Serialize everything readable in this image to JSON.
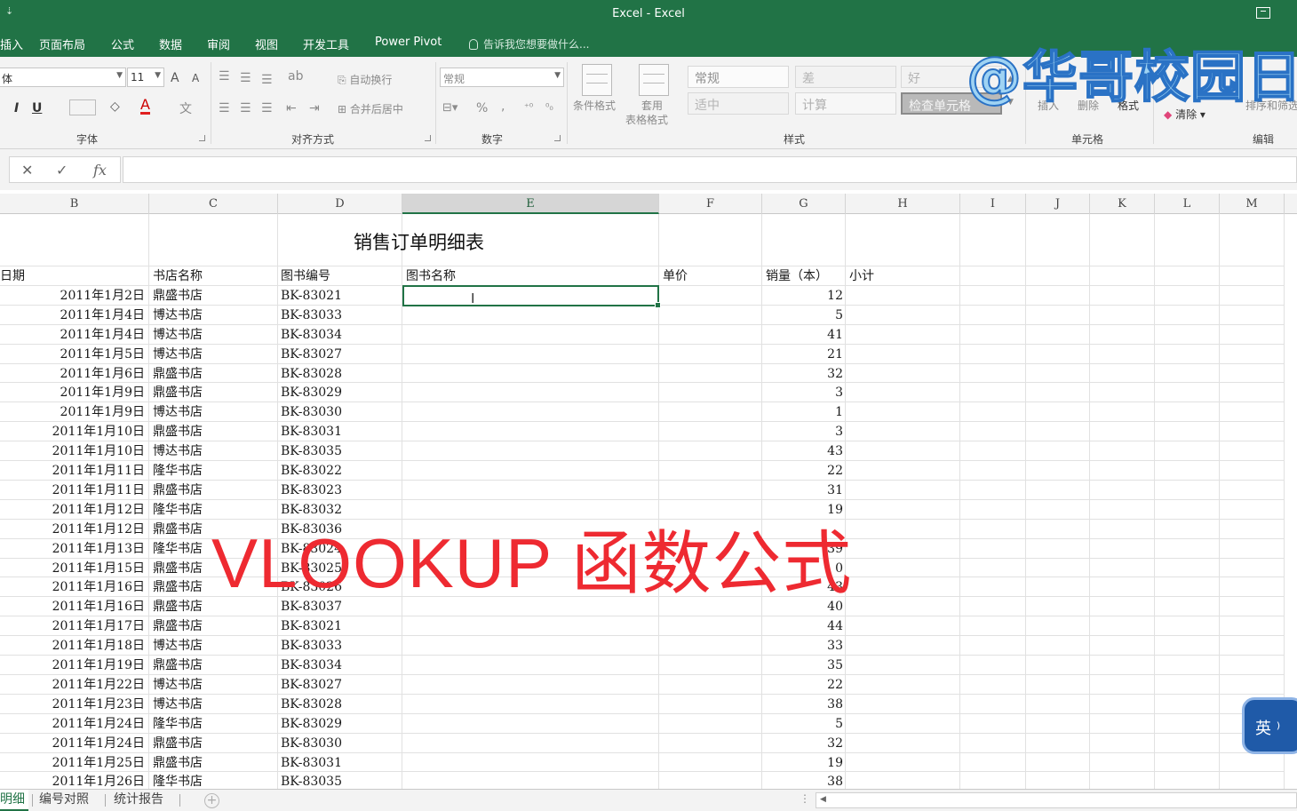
{
  "window": {
    "title": "Excel - Excel",
    "quick_access": "⇣"
  },
  "tabs": [
    "插入",
    "页面布局",
    "公式",
    "数据",
    "审阅",
    "视图",
    "开发工具",
    "Power Pivot"
  ],
  "tell_me": "告诉我您想要做什么...",
  "ribbon": {
    "font_name": "体",
    "font_size": "11",
    "grow_font": "A",
    "shrink_font": "A",
    "italic": "I",
    "underline": "U",
    "font_color": "A",
    "group_font": "字体",
    "wrap_text": "自动换行",
    "merge_center": "合并后居中",
    "group_alignment": "对齐方式",
    "number_format": "常规",
    "percent": "%",
    "comma": ",",
    "group_number": "数字",
    "conditional_format": "条件格式",
    "format_table_1": "套用",
    "format_table_2": "表格格式",
    "styles": [
      "常规",
      "差",
      "好",
      "适中",
      "计算",
      "检查单元格"
    ],
    "group_styles": "样式",
    "insert": "插入",
    "delete": "删除",
    "format": "格式",
    "group_cells": "单元格",
    "clear": "清除",
    "sort_filter": "排序和筛选",
    "group_editing": "编辑"
  },
  "formula_bar": {
    "cancel": "✕",
    "enter": "✓",
    "fx": "fx",
    "content": ""
  },
  "columns": [
    "B",
    "C",
    "D",
    "E",
    "F",
    "G",
    "H",
    "I",
    "J",
    "K",
    "L",
    "M"
  ],
  "sheet": {
    "title": "销售订单明细表",
    "headers": {
      "date": "日期",
      "store": "书店名称",
      "code": "图书编号",
      "name": "图书名称",
      "price": "单价",
      "qty": "销量（本）",
      "subtotal": "小计"
    },
    "rows": [
      [
        "2011年1月2日",
        "鼎盛书店",
        "BK-83021",
        "12"
      ],
      [
        "2011年1月4日",
        "博达书店",
        "BK-83033",
        "5"
      ],
      [
        "2011年1月4日",
        "博达书店",
        "BK-83034",
        "41"
      ],
      [
        "2011年1月5日",
        "博达书店",
        "BK-83027",
        "21"
      ],
      [
        "2011年1月6日",
        "鼎盛书店",
        "BK-83028",
        "32"
      ],
      [
        "2011年1月9日",
        "鼎盛书店",
        "BK-83029",
        "3"
      ],
      [
        "2011年1月9日",
        "博达书店",
        "BK-83030",
        "1"
      ],
      [
        "2011年1月10日",
        "鼎盛书店",
        "BK-83031",
        "3"
      ],
      [
        "2011年1月10日",
        "博达书店",
        "BK-83035",
        "43"
      ],
      [
        "2011年1月11日",
        "隆华书店",
        "BK-83022",
        "22"
      ],
      [
        "2011年1月11日",
        "鼎盛书店",
        "BK-83023",
        "31"
      ],
      [
        "2011年1月12日",
        "隆华书店",
        "BK-83032",
        "19"
      ],
      [
        "2011年1月12日",
        "鼎盛书店",
        "BK-83036",
        ""
      ],
      [
        "2011年1月13日",
        "隆华书店",
        "BK-83024",
        "39"
      ],
      [
        "2011年1月15日",
        "鼎盛书店",
        "BK-83025",
        "0"
      ],
      [
        "2011年1月16日",
        "鼎盛书店",
        "BK-83026",
        "43"
      ],
      [
        "2011年1月16日",
        "鼎盛书店",
        "BK-83037",
        "40"
      ],
      [
        "2011年1月17日",
        "鼎盛书店",
        "BK-83021",
        "44"
      ],
      [
        "2011年1月18日",
        "博达书店",
        "BK-83033",
        "33"
      ],
      [
        "2011年1月19日",
        "鼎盛书店",
        "BK-83034",
        "35"
      ],
      [
        "2011年1月22日",
        "博达书店",
        "BK-83027",
        "22"
      ],
      [
        "2011年1月23日",
        "博达书店",
        "BK-83028",
        "38"
      ],
      [
        "2011年1月24日",
        "隆华书店",
        "BK-83029",
        "5"
      ],
      [
        "2011年1月24日",
        "鼎盛书店",
        "BK-83030",
        "32"
      ],
      [
        "2011年1月25日",
        "鼎盛书店",
        "BK-83031",
        "19"
      ],
      [
        "2011年1月26日",
        "隆华书店",
        "BK-83035",
        "38"
      ]
    ]
  },
  "sheet_tabs": [
    "明细",
    "编号对照",
    "统计报告"
  ],
  "overlays": {
    "watermark": "@华哥校园日",
    "caption": "VLOOKUP 函数公式",
    "ime": "英 ⁾"
  },
  "colors": {
    "excel_green": "#217346",
    "caption_red": "#ee2a31",
    "watermark_blue": "#2a72c5"
  }
}
